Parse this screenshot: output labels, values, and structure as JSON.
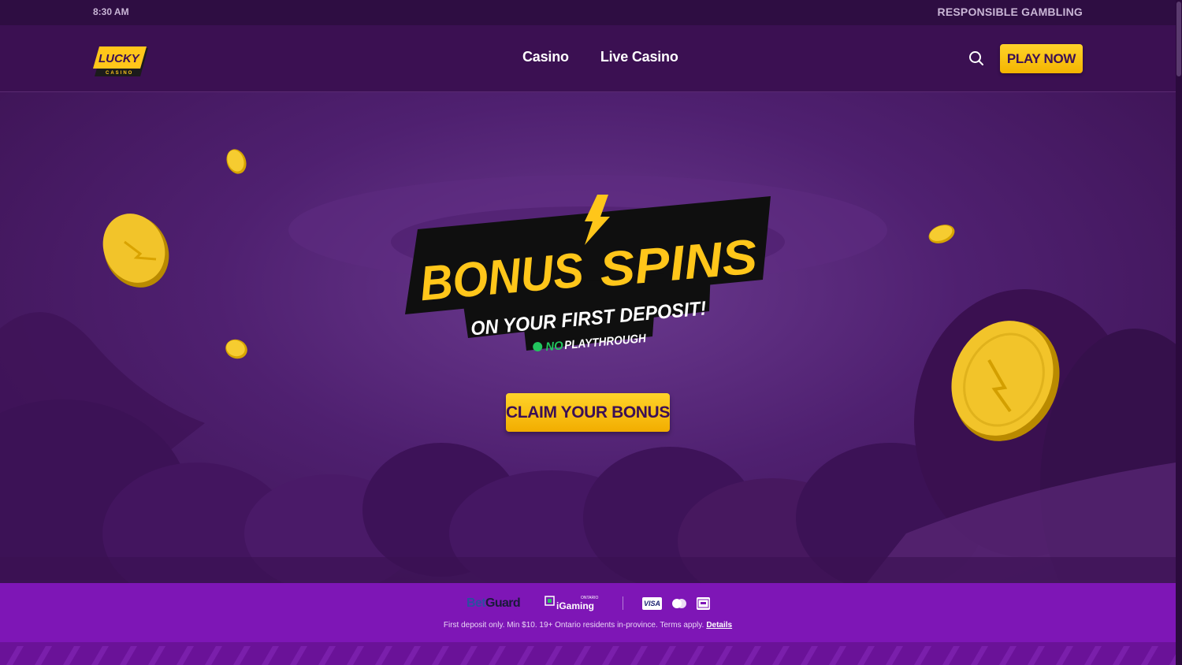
{
  "topbar": {
    "time": "8:30 AM",
    "responsible": "RESPONSIBLE GAMBLING"
  },
  "header": {
    "logo": {
      "top": "LUCKY",
      "bottom": "CASINO"
    },
    "nav": [
      {
        "label": "Casino"
      },
      {
        "label": "Live Casino"
      }
    ],
    "play_now": "PLAY NOW"
  },
  "hero": {
    "headline_left": "BONUS",
    "headline_right": "SPINS",
    "subline": "ON YOUR FIRST DEPOSIT!",
    "badge_no": "NO",
    "badge_rest": "PLAYTHROUGH",
    "cta": "CLAIM YOUR BONUS"
  },
  "footer": {
    "betguard": {
      "bet": "Bet",
      "guard": "Guard"
    },
    "igaming": {
      "text": "iGaming",
      "sup": "ONTARIO"
    },
    "payments": [
      "visa",
      "mastercard",
      "interac"
    ],
    "visa_label": "VISA",
    "disclaimer": "First deposit only. Min $10. 19+ Ontario residents in-province. Terms apply.",
    "details": "Details"
  },
  "colors": {
    "accent": "#ffc61a",
    "brand": "#3b1052",
    "footer": "#7e16b6"
  }
}
